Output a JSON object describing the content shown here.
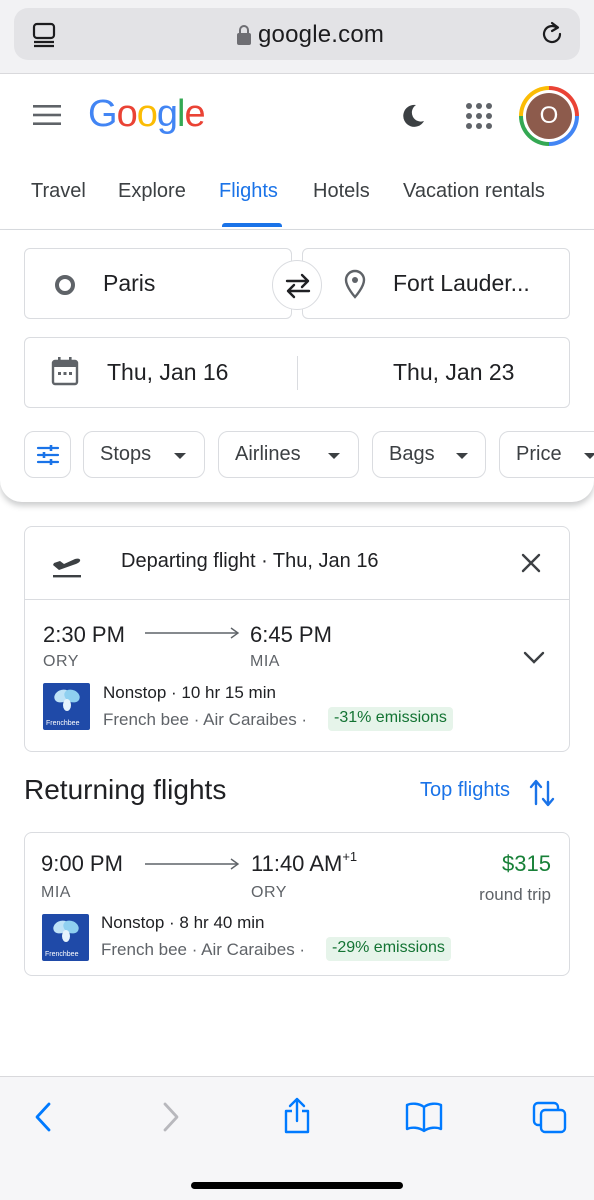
{
  "browser": {
    "host": "google.com",
    "icons": [
      "reader-icon",
      "lock-icon",
      "reload-icon"
    ],
    "toolbar_icons": [
      "back-icon",
      "forward-icon",
      "share-icon",
      "bookmarks-icon",
      "tabs-icon"
    ],
    "accent": "#007aff"
  },
  "header": {
    "logo_letters": [
      "G",
      "o",
      "o",
      "g",
      "l",
      "e"
    ],
    "avatar_initial": "O",
    "icons": [
      "menu-icon",
      "dark-mode-icon",
      "apps-icon"
    ]
  },
  "tabs": [
    {
      "label": "Travel",
      "active": false
    },
    {
      "label": "Explore",
      "active": false
    },
    {
      "label": "Flights",
      "active": true
    },
    {
      "label": "Hotels",
      "active": false
    },
    {
      "label": "Vacation rentals",
      "active": false
    }
  ],
  "search": {
    "origin": "Paris",
    "destination": "Fort Lauder...",
    "depart_date": "Thu, Jan 16",
    "return_date": "Thu, Jan 23",
    "filters": [
      {
        "label": "Stops"
      },
      {
        "label": "Airlines"
      },
      {
        "label": "Bags"
      },
      {
        "label": "Price"
      }
    ]
  },
  "departing": {
    "title": "Departing flight · Thu, Jan 16",
    "depart_time": "2:30 PM",
    "arrive_time": "6:45 PM",
    "from_code": "ORY",
    "to_code": "MIA",
    "stops_duration": "Nonstop · 10 hr 15 min",
    "airlines": "French bee · Air Caraibes ·",
    "emissions": "-31% emissions",
    "airline_logo_text": "Frenchbee"
  },
  "returning": {
    "section_title": "Returning flights",
    "sort_label": "Top flights",
    "flights": [
      {
        "depart_time": "9:00 PM",
        "arrive_time": "11:40 AM",
        "day_offset": "+1",
        "from_code": "MIA",
        "to_code": "ORY",
        "stops_duration": "Nonstop · 8 hr 40 min",
        "airlines": "French bee · Air Caraibes ·",
        "emissions": "-29% emissions",
        "price": "$315",
        "price_note": "round trip",
        "airline_logo_text": "Frenchbee"
      }
    ]
  },
  "colors": {
    "google_blue": "#1a73e8",
    "price_green": "#188038",
    "emissions_bg": "#e6f4ea",
    "emissions_text": "#137333"
  }
}
